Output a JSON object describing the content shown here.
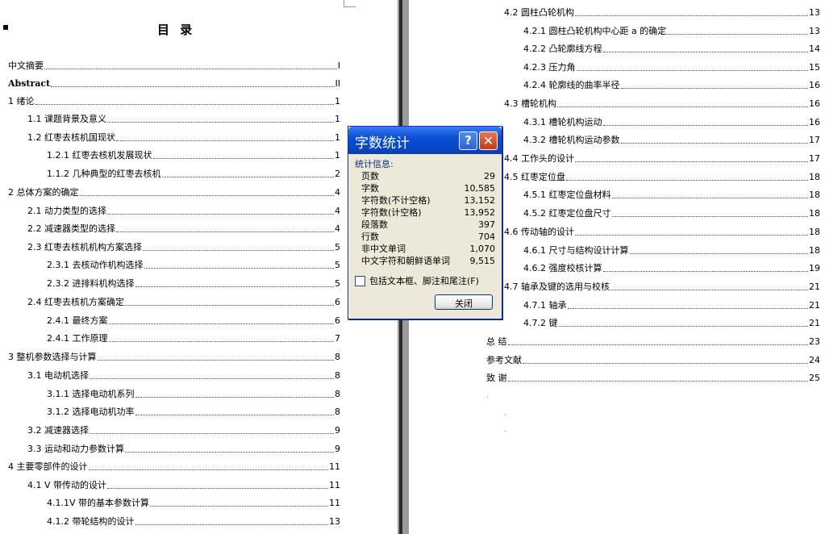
{
  "left": {
    "title": "目  录",
    "entries": [
      {
        "text": "中文摘要",
        "page": "I"
      },
      {
        "text": "Abstract",
        "page": "II"
      },
      {
        "text": "1  绪论",
        "page": "1"
      },
      {
        "text": "1.1 课题背景及意义",
        "page": "1"
      },
      {
        "text": "1.2 红枣去核机国现状",
        "page": "1"
      },
      {
        "text": "1.2.1 红枣去核机发展现状",
        "page": "1"
      },
      {
        "text": "1.1.2 几种典型的红枣去核机",
        "page": "2"
      },
      {
        "text": "2  总体方案的确定",
        "page": "4"
      },
      {
        "text": "2.1 动力类型的选择",
        "page": "4"
      },
      {
        "text": "2.2 减速器类型的选择",
        "page": "4"
      },
      {
        "text": "2.3 红枣去核机机构方案选择",
        "page": "5"
      },
      {
        "text": "2.3.1 去核动作机构选择",
        "page": "5"
      },
      {
        "text": "2.3.2 进排料机构选择",
        "page": "5"
      },
      {
        "text": "2.4 红枣去核机方案确定",
        "page": "6"
      },
      {
        "text": "2.4.1 最终方案",
        "page": "6"
      },
      {
        "text": "2.4.1 工作原理",
        "page": "7"
      },
      {
        "text": "3  整机参数选择与计算",
        "page": "8"
      },
      {
        "text": "3.1 电动机选择",
        "page": "8"
      },
      {
        "text": "3.1.1 选择电动机系列",
        "page": "8"
      },
      {
        "text": "3.1.2 选择电动机功率",
        "page": "8"
      },
      {
        "text": "3.2 减速器选择",
        "page": "9"
      },
      {
        "text": "3.3 运动和动力参数计算",
        "page": "9"
      },
      {
        "text": "4  主要零部件的设计",
        "page": "11"
      },
      {
        "text": "4.1 V 带传动的设计",
        "page": "11"
      },
      {
        "text": "4.1.1V 带的基本参数计算",
        "page": "11"
      },
      {
        "text": "4.1.2 带轮结构的设计",
        "page": "13"
      }
    ]
  },
  "right": {
    "entries": [
      {
        "text": "4.2 圆柱凸轮机构",
        "page": "13"
      },
      {
        "text": "4.2.1 圆柱凸轮机构中心距  a 的确定",
        "page": "13"
      },
      {
        "text": "4.2.2 凸轮廓线方程",
        "page": "14"
      },
      {
        "text": "4.2.3 压力角",
        "page": "15"
      },
      {
        "text": "4.2.4 轮廓线的曲率半径",
        "page": "16"
      },
      {
        "text": "4.3 槽轮机构",
        "page": "16"
      },
      {
        "text": "4.3.1 槽轮机构运动",
        "page": "16"
      },
      {
        "text": "4.3.2 槽轮机构运动参数",
        "page": "17"
      },
      {
        "text": "4.4 工作头的设计",
        "page": "17"
      },
      {
        "text": "4.5  红枣定位盘",
        "page": "18"
      },
      {
        "text": "4.5.1  红枣定位盘材料",
        "page": "18"
      },
      {
        "text": "4.5.2  红枣定位盘尺寸",
        "page": "18"
      },
      {
        "text": "4.6 传动轴的设计",
        "page": "18"
      },
      {
        "text": "4.6.1 尺寸与结构设计计算",
        "page": "18"
      },
      {
        "text": "4.6.2 强度校核计算",
        "page": "19"
      },
      {
        "text": "4.7 轴承及键的选用与校核",
        "page": "21"
      },
      {
        "text": "4.7.1 轴承",
        "page": "21"
      },
      {
        "text": "4.7.2 键",
        "page": "21"
      },
      {
        "text": "总  结",
        "page": "23"
      },
      {
        "text": "参考文献",
        "page": "24"
      },
      {
        "text": "致    谢",
        "page": "25"
      }
    ]
  },
  "dialog": {
    "title": "字数统计",
    "help": "?",
    "close_glyph": "✕",
    "group_label": "统计信息:",
    "stats": [
      {
        "label": "页数",
        "value": "29"
      },
      {
        "label": "字数",
        "value": "10,585"
      },
      {
        "label": "字符数(不计空格)",
        "value": "13,152"
      },
      {
        "label": "字符数(计空格)",
        "value": "13,952"
      },
      {
        "label": "段落数",
        "value": "397"
      },
      {
        "label": "行数",
        "value": "704"
      },
      {
        "label": "非中文单词",
        "value": "1,070"
      },
      {
        "label": "中文字符和朝鲜语单词",
        "value": "9,515"
      }
    ],
    "checkbox_label": "包括文本框、脚注和尾注(F)",
    "close_button": "关闭"
  }
}
